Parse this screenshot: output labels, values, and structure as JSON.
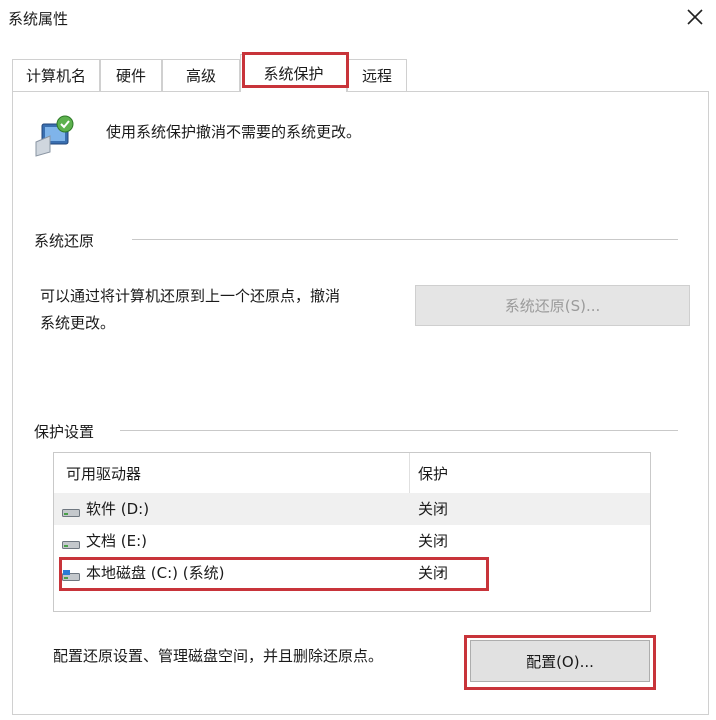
{
  "window": {
    "title": "系统属性"
  },
  "tabs": [
    {
      "label": "计算机名"
    },
    {
      "label": "硬件"
    },
    {
      "label": "高级"
    },
    {
      "label": "系统保护"
    },
    {
      "label": "远程"
    }
  ],
  "intro": {
    "text": "使用系统保护撤消不需要的系统更改。"
  },
  "restore": {
    "group_label": "系统还原",
    "description_line1": "可以通过将计算机还原到上一个还原点，撤消",
    "description_line2": "系统更改。",
    "button_label": "系统还原(S)..."
  },
  "protection": {
    "group_label": "保护设置",
    "columns": [
      "可用驱动器",
      "保护"
    ],
    "drives": [
      {
        "name": "软件 (D:)",
        "status": "关闭"
      },
      {
        "name": "文档 (E:)",
        "status": "关闭"
      },
      {
        "name": "本地磁盘 (C:) (系统)",
        "status": "关闭"
      }
    ],
    "config_text": "配置还原设置、管理磁盘空间，并且删除还原点。",
    "config_button": "配置(O)..."
  },
  "colors": {
    "highlight": "#c8343a",
    "selected_row": "#f0f0f0",
    "disabled_text": "#9b9b9b"
  },
  "icons": [
    "close-icon",
    "system-protection-icon",
    "drive-icon",
    "system-drive-icon"
  ]
}
